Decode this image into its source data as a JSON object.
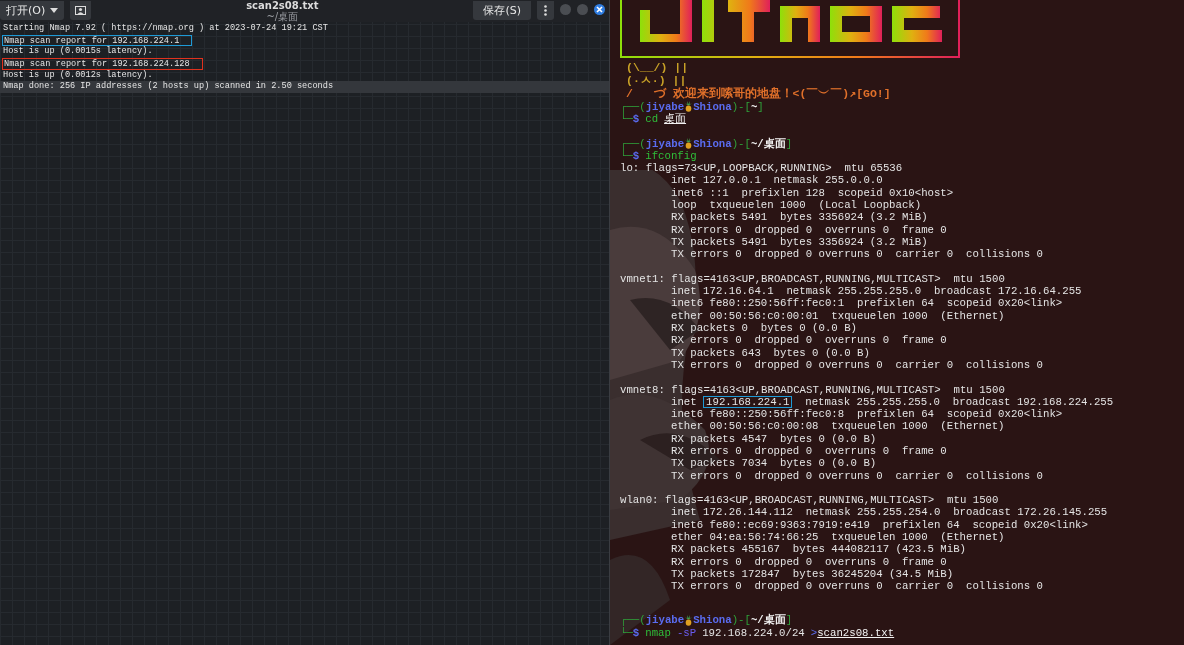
{
  "editor": {
    "open_button": "打开(O)",
    "title": "scan2s08.txt",
    "subtitle": "~/桌面",
    "save_button": "保存(S)",
    "lines": [
      {
        "text": "Starting Nmap 7.92 ( https://nmap.org ) at 2023-07-24 19:21 CST",
        "current": false
      },
      {
        "text": "Nmap scan report for 192.168.224.1",
        "current": false,
        "color": "#1e9ad6"
      },
      {
        "text": "Host is up (0.0015s latency).",
        "current": false
      },
      {
        "text": "Nmap scan report for 192.168.224.128",
        "current": false,
        "color": "#e0321e"
      },
      {
        "text": "Host is up (0.0012s latency).",
        "current": false
      },
      {
        "text": "Nmap done: 256 IP addresses (2 hosts up) scanned in 2.50 seconds",
        "current": true
      }
    ]
  },
  "terminal": {
    "banner_lines": [
      {
        "text": "(\\__/) ||",
        "color": "#c9a227"
      },
      {
        "text": "(·ㅅ·) ||",
        "color": "#c9a227"
      },
      {
        "text": "/   づ 欢迎来到嗦哥的地盘！<(￣︶￣)↗[GO!]",
        "color": "#e0702a"
      }
    ],
    "sessions": [
      {
        "prompt": [
          {
            "text": "┌──(",
            "kind": "frame"
          },
          {
            "text": "jiyabe",
            "kind": "user"
          },
          {
            "kind": "icon"
          },
          {
            "text": "Shiona",
            "kind": "user"
          },
          {
            "text": ")-[",
            "kind": "frame"
          },
          {
            "text": "~",
            "kind": "dir"
          },
          {
            "text": "]",
            "kind": "frame"
          }
        ],
        "command": [
          {
            "text": "└─",
            "kind": "frame"
          },
          {
            "text": "$",
            "kind": "dollar"
          },
          {
            "text": "cd",
            "kind": "command"
          },
          {
            "text": "桌面",
            "kind": "path"
          }
        ]
      },
      {
        "prompt": [
          {
            "text": "┌──(",
            "kind": "frame"
          },
          {
            "text": "jiyabe",
            "kind": "user"
          },
          {
            "kind": "icon"
          },
          {
            "text": "Shiona",
            "kind": "user"
          },
          {
            "text": ")-[",
            "kind": "frame"
          },
          {
            "text": "~/桌面",
            "kind": "dir"
          },
          {
            "text": "]",
            "kind": "frame"
          }
        ],
        "command": [
          {
            "text": "└─",
            "kind": "frame"
          },
          {
            "text": "$",
            "kind": "dollar"
          },
          {
            "text": "ifconfig",
            "kind": "command"
          }
        ],
        "output": [
          {
            "header": "lo: flags=73<UP,LOOPBACK,RUNNING>  mtu 65536",
            "details": [
              "inet 127.0.0.1  netmask 255.0.0.0",
              "inet6 ::1  prefixlen 128  scopeid 0x10<host>",
              "loop  txqueuelen 1000  (Local Loopback)",
              "RX packets 5491  bytes 3356924 (3.2 MiB)",
              "RX errors 0  dropped 0  overruns 0  frame 0",
              "TX packets 5491  bytes 3356924 (3.2 MiB)",
              "TX errors 0  dropped 0 overruns 0  carrier 0  collisions 0"
            ]
          },
          {
            "header": "vmnet1: flags=4163<UP,BROADCAST,RUNNING,MULTICAST>  mtu 1500",
            "details": [
              "inet 172.16.64.1  netmask 255.255.255.0  broadcast 172.16.64.255",
              "inet6 fe80::250:56ff:fec0:1  prefixlen 64  scopeid 0x20<link>",
              "ether 00:50:56:c0:00:01  txqueuelen 1000  (Ethernet)",
              "RX packets 0  bytes 0 (0.0 B)",
              "RX errors 0  dropped 0  overruns 0  frame 0",
              "TX packets 643  bytes 0 (0.0 B)",
              "TX errors 0  dropped 0 overruns 0  carrier 0  collisions 0"
            ]
          },
          {
            "header": "vmnet8: flags=4163<UP,BROADCAST,RUNNING,MULTICAST>  mtu 1500",
            "details": [
              {
                "segments": [
                  {
                    "text": "inet "
                  },
                  {
                    "text": "192.168.224.1",
                    "color": "#1e9ad6"
                  },
                  {
                    "text": "  netmask 255.255.255.0  broadcast 192.168.224.255"
                  }
                ]
              },
              "inet6 fe80::250:56ff:fec0:8  prefixlen 64  scopeid 0x20<link>",
              "ether 00:50:56:c0:00:08  txqueuelen 1000  (Ethernet)",
              "RX packets 4547  bytes 0 (0.0 B)",
              "RX errors 0  dropped 0  overruns 0  frame 0",
              "TX packets 7034  bytes 0 (0.0 B)",
              "TX errors 0  dropped 0 overruns 0  carrier 0  collisions 0"
            ]
          },
          {
            "header": "wlan0: flags=4163<UP,BROADCAST,RUNNING,MULTICAST>  mtu 1500",
            "details": [
              "inet 172.26.144.112  netmask 255.255.254.0  broadcast 172.26.145.255",
              "inet6 fe80::ec69:9363:7919:e419  prefixlen 64  scopeid 0x20<link>",
              "ether 04:ea:56:74:66:25  txqueuelen 1000  (Ethernet)",
              "RX packets 455167  bytes 444082117 (423.5 MiB)",
              "RX errors 0  dropped 0  overruns 0  frame 0",
              "TX packets 172847  bytes 36245204 (34.5 MiB)",
              "TX errors 0  dropped 0 overruns 0  carrier 0  collisions 0"
            ]
          }
        ]
      },
      {
        "prompt": [
          {
            "text": "┌──(",
            "kind": "frame"
          },
          {
            "text": "jiyabe",
            "kind": "user"
          },
          {
            "kind": "icon"
          },
          {
            "text": "Shiona",
            "kind": "user"
          },
          {
            "text": ")-[",
            "kind": "frame"
          },
          {
            "text": "~/桌面",
            "kind": "dir"
          },
          {
            "text": "]",
            "kind": "frame"
          }
        ],
        "command": [
          {
            "text": "└─",
            "kind": "frame"
          },
          {
            "text": "$",
            "kind": "dollar"
          },
          {
            "text": "nmap",
            "kind": "command"
          },
          {
            "text": "-sP",
            "kind": "option"
          },
          {
            "text": "192.168.224.0/24",
            "kind": "arg"
          },
          {
            "text": ">",
            "kind": "redirect"
          },
          {
            "text": "scan2s08.txt",
            "kind": "path"
          }
        ]
      }
    ]
  }
}
